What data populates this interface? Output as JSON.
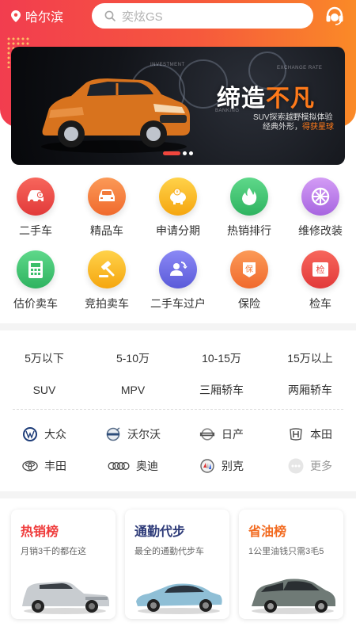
{
  "header": {
    "location": "哈尔滨",
    "search_placeholder": "奕炫GS"
  },
  "banner": {
    "slogan_main": "缔造",
    "slogan_accent": "不凡",
    "line1": "SUV探索越野模拟体验",
    "line2_prefix": "经典外形，",
    "line2_accent": "得获星球",
    "tag_a": "INVESTMENT",
    "tag_b": "EXCHANGE RATE",
    "tag_c": "BANKING",
    "slides": 3,
    "active_slide": 1
  },
  "quick_menu": [
    {
      "label": "二手车",
      "icon": "used-car-icon",
      "color": "#ef4a43"
    },
    {
      "label": "精品车",
      "icon": "premium-car-icon",
      "color": "#f6783a"
    },
    {
      "label": "申请分期",
      "icon": "piggy-bank-icon",
      "color": "#f6b21e"
    },
    {
      "label": "热销排行",
      "icon": "flame-icon",
      "color": "#3bbf6a"
    },
    {
      "label": "维修改装",
      "icon": "wheel-icon",
      "color": "#b77ae6"
    },
    {
      "label": "估价卖车",
      "icon": "calculator-icon",
      "color": "#3bbf6a"
    },
    {
      "label": "竞拍卖车",
      "icon": "gavel-icon",
      "color": "#f6b21e"
    },
    {
      "label": "二手车过户",
      "icon": "transfer-icon",
      "color": "#6f6fe6"
    },
    {
      "label": "保险",
      "icon": "insurance-icon",
      "color": "#f6783a"
    },
    {
      "label": "检车",
      "icon": "inspection-icon",
      "color": "#ef4a43"
    }
  ],
  "price_filters": [
    "5万以下",
    "5-10万",
    "10-15万",
    "15万以上"
  ],
  "type_filters": [
    "SUV",
    "MPV",
    "三厢轿车",
    "两厢轿车"
  ],
  "brands": [
    {
      "label": "大众",
      "icon": "volkswagen-logo-icon"
    },
    {
      "label": "沃尔沃",
      "icon": "volvo-logo-icon"
    },
    {
      "label": "日产",
      "icon": "nissan-logo-icon"
    },
    {
      "label": "本田",
      "icon": "honda-logo-icon"
    },
    {
      "label": "丰田",
      "icon": "toyota-logo-icon"
    },
    {
      "label": "奥迪",
      "icon": "audi-logo-icon"
    },
    {
      "label": "别克",
      "icon": "buick-logo-icon"
    },
    {
      "label": "更多",
      "icon": "more-icon"
    }
  ],
  "cards": [
    {
      "title": "热销榜",
      "subtitle": "月销3千的都在这",
      "color": "#ef3b3b"
    },
    {
      "title": "通勤代步",
      "subtitle": "最全的通勤代步车",
      "color": "#2d3a78"
    },
    {
      "title": "省油榜",
      "subtitle": "1公里油钱只需3毛5",
      "color": "#f26a1f"
    }
  ]
}
